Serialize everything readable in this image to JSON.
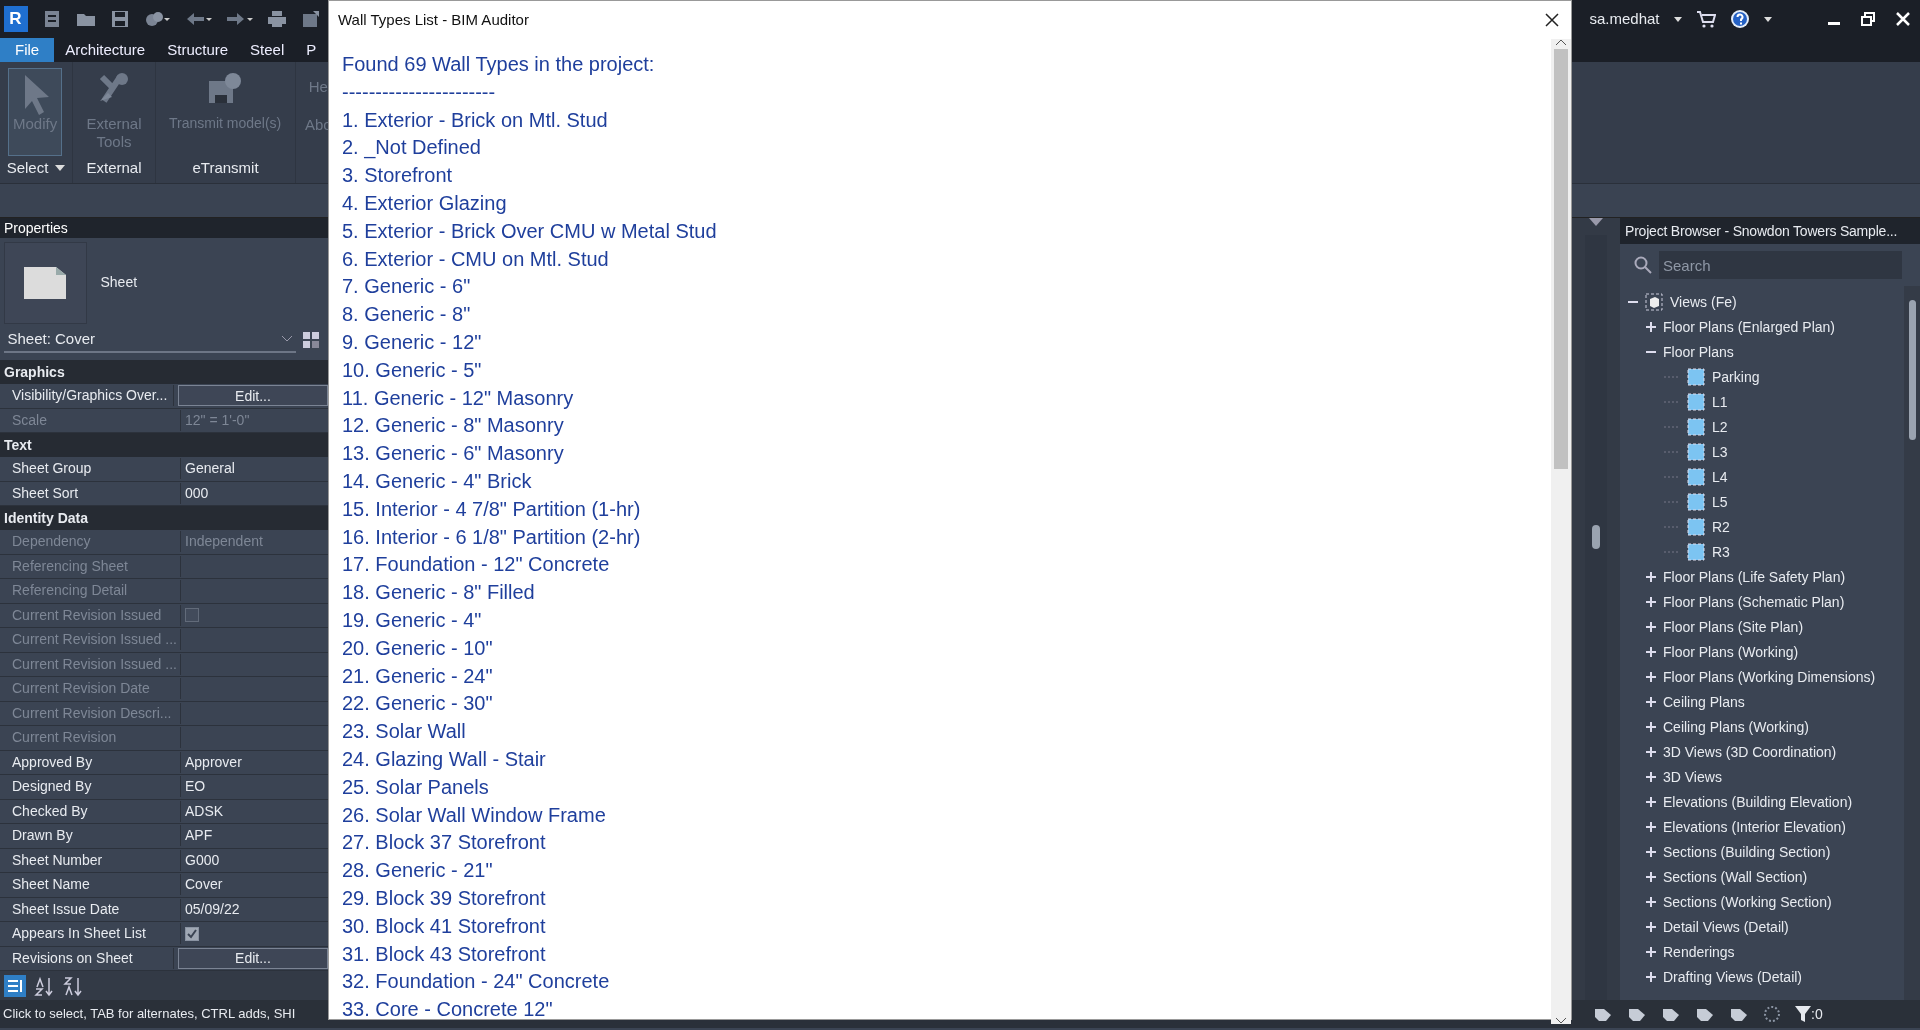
{
  "app": {
    "logo": "R",
    "user": "sa.medhat",
    "tabs": [
      {
        "label": "File",
        "selected": true
      },
      {
        "label": "Architecture",
        "selected": false
      },
      {
        "label": "Structure",
        "selected": false
      },
      {
        "label": "Steel",
        "selected": false
      },
      {
        "label": "P",
        "selected": false
      }
    ]
  },
  "ribbon": {
    "panels": [
      {
        "title": "Select",
        "dropdown": true,
        "tools": [
          {
            "kind": "large",
            "label": "Modify",
            "selected": true,
            "disabled": true
          }
        ]
      },
      {
        "title": "External",
        "tools": [
          {
            "kind": "large",
            "label": "External Tools",
            "selected": false,
            "disabled": true
          }
        ]
      },
      {
        "title": "eTransmit",
        "tools": [
          {
            "kind": "large",
            "label": "Transmit model(s)",
            "selected": false,
            "disabled": true
          }
        ]
      },
      {
        "tools": [
          {
            "kind": "small",
            "label": "He",
            "disabled": true
          },
          {
            "kind": "small",
            "label": "Abo",
            "disabled": true
          }
        ]
      }
    ]
  },
  "properties": {
    "title": "Properties",
    "type_name": "Sheet",
    "selector": "Sheet: Cover",
    "sections": [
      {
        "title": "Graphics",
        "rows": [
          {
            "kind": "button",
            "label": "Visibility/Graphics Over...",
            "value": "Edit...",
            "disabled": false
          },
          {
            "kind": "text",
            "label": "Scale",
            "value": "12\" = 1'-0\"",
            "disabled": true
          }
        ]
      },
      {
        "title": "Text",
        "rows": [
          {
            "kind": "text",
            "label": "Sheet Group",
            "value": "General",
            "disabled": false
          },
          {
            "kind": "text",
            "label": "Sheet Sort",
            "value": "000",
            "disabled": false
          }
        ]
      },
      {
        "title": "Identity Data",
        "rows": [
          {
            "kind": "text",
            "label": "Dependency",
            "value": "Independent",
            "disabled": true
          },
          {
            "kind": "text",
            "label": "Referencing Sheet",
            "disabled": true
          },
          {
            "kind": "text",
            "label": "Referencing Detail",
            "disabled": true
          },
          {
            "kind": "checkbox",
            "label": "Current Revision Issued",
            "checked": false,
            "disabled": true
          },
          {
            "kind": "text",
            "label": "Current Revision Issued ...",
            "disabled": true
          },
          {
            "kind": "text",
            "label": "Current Revision Issued ...",
            "disabled": true
          },
          {
            "kind": "text",
            "label": "Current Revision Date",
            "disabled": true
          },
          {
            "kind": "text",
            "label": "Current Revision Descri...",
            "disabled": true
          },
          {
            "kind": "text",
            "label": "Current Revision",
            "disabled": true
          },
          {
            "kind": "text",
            "label": "Approved By",
            "value": "Approver",
            "disabled": false
          },
          {
            "kind": "text",
            "label": "Designed By",
            "value": "EO",
            "disabled": false
          },
          {
            "kind": "text",
            "label": "Checked By",
            "value": "ADSK",
            "disabled": false
          },
          {
            "kind": "text",
            "label": "Drawn By",
            "value": "APF",
            "disabled": false
          },
          {
            "kind": "text",
            "label": "Sheet Number",
            "value": "G000",
            "disabled": false
          },
          {
            "kind": "text",
            "label": "Sheet Name",
            "value": "Cover",
            "disabled": false
          },
          {
            "kind": "text",
            "label": "Sheet Issue Date",
            "value": "05/09/22",
            "disabled": false
          },
          {
            "kind": "checkbox",
            "label": "Appears In Sheet List",
            "checked": true,
            "disabled": false
          },
          {
            "kind": "button",
            "label": "Revisions on Sheet",
            "value": "Edit...",
            "disabled": false
          }
        ]
      }
    ]
  },
  "status_text": "Click to select, TAB for alternates, CTRL adds, SHI",
  "dialog": {
    "title": "Wall Types List - BIM Auditor",
    "heading": "Found 69 Wall Types in the project:",
    "separator": "-----------------------",
    "items": [
      "1. Exterior - Brick on Mtl. Stud",
      "2. _Not Defined",
      "3. Storefront",
      "4. Exterior Glazing",
      "5. Exterior - Brick Over CMU w Metal Stud",
      "6. Exterior - CMU on Mtl. Stud",
      "7. Generic - 6\"",
      "8. Generic - 8\"",
      "9. Generic - 12\"",
      "10. Generic - 5\"",
      "11. Generic - 12\" Masonry",
      "12. Generic - 8\" Masonry",
      "13. Generic - 6\" Masonry",
      "14. Generic - 4\" Brick",
      "15. Interior - 4 7/8\" Partition (1-hr)",
      "16. Interior - 6 1/8\" Partition (2-hr)",
      "17. Foundation - 12\" Concrete",
      "18. Generic - 8\" Filled",
      "19. Generic - 4\"",
      "20. Generic - 10\"",
      "21. Generic - 24\"",
      "22. Generic - 30\"",
      "23. Solar Wall",
      "24. Glazing Wall - Stair",
      "25. Solar Panels",
      "26. Solar Wall Window Frame",
      "27. Block 37 Storefront",
      "28. Generic - 21\"",
      "29. Block 39 Storefront",
      "30. Block 41 Storefront",
      "31. Block 43 Storefront",
      "32. Foundation - 24\" Concrete",
      "33. Core - Concrete 12\""
    ]
  },
  "project_browser": {
    "title": "Project Browser - Snowdon Towers Sample...",
    "search_placeholder": "Search",
    "tree": [
      {
        "kind": "root",
        "label": "Views (Fe)",
        "expanded": true,
        "children": [
          {
            "kind": "group",
            "label": "Floor Plans (Enlarged Plan)",
            "expanded": false
          },
          {
            "kind": "group",
            "label": "Floor Plans",
            "expanded": true,
            "children": [
              {
                "kind": "view",
                "label": "Parking"
              },
              {
                "kind": "view",
                "label": "L1"
              },
              {
                "kind": "view",
                "label": "L2"
              },
              {
                "kind": "view",
                "label": "L3"
              },
              {
                "kind": "view",
                "label": "L4"
              },
              {
                "kind": "view",
                "label": "L5"
              },
              {
                "kind": "view",
                "label": "R2"
              },
              {
                "kind": "view",
                "label": "R3"
              }
            ]
          },
          {
            "kind": "group",
            "label": "Floor Plans (Life Safety Plan)",
            "expanded": false
          },
          {
            "kind": "group",
            "label": "Floor Plans (Schematic Plan)",
            "expanded": false
          },
          {
            "kind": "group",
            "label": "Floor Plans (Site Plan)",
            "expanded": false
          },
          {
            "kind": "group",
            "label": "Floor Plans (Working)",
            "expanded": false
          },
          {
            "kind": "group",
            "label": "Floor Plans (Working Dimensions)",
            "expanded": false
          },
          {
            "kind": "group",
            "label": "Ceiling Plans",
            "expanded": false
          },
          {
            "kind": "group",
            "label": "Ceiling Plans (Working)",
            "expanded": false
          },
          {
            "kind": "group",
            "label": "3D Views (3D Coordination)",
            "expanded": false
          },
          {
            "kind": "group",
            "label": "3D Views",
            "expanded": false
          },
          {
            "kind": "group",
            "label": "Elevations (Building Elevation)",
            "expanded": false
          },
          {
            "kind": "group",
            "label": "Elevations (Interior Elevation)",
            "expanded": false
          },
          {
            "kind": "group",
            "label": "Sections (Building Section)",
            "expanded": false
          },
          {
            "kind": "group",
            "label": "Sections (Wall Section)",
            "expanded": false
          },
          {
            "kind": "group",
            "label": "Sections (Working Section)",
            "expanded": false
          },
          {
            "kind": "group",
            "label": "Detail Views (Detail)",
            "expanded": false
          },
          {
            "kind": "group",
            "label": "Renderings",
            "expanded": false
          },
          {
            "kind": "group",
            "label": "Drafting Views (Detail)",
            "expanded": false
          }
        ]
      }
    ]
  },
  "filter_count": ":0"
}
